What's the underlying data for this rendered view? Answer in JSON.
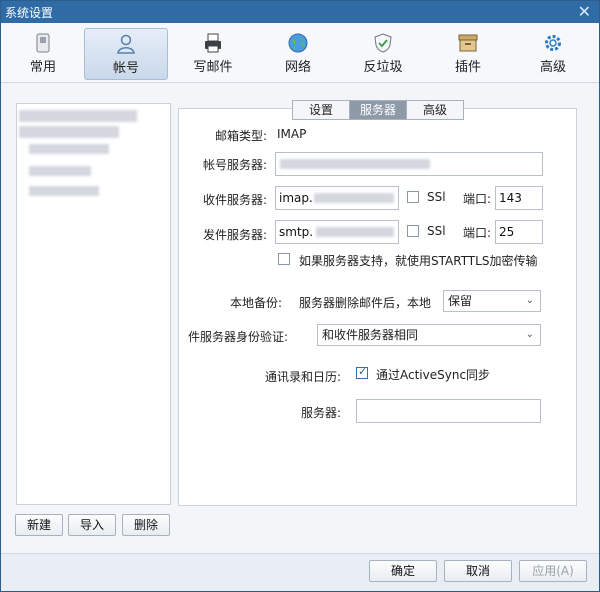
{
  "window": {
    "title": "系统设置",
    "close_label": "✕"
  },
  "toolbar": [
    {
      "name": "tool-general",
      "label": "常用",
      "icon": "phone-icon"
    },
    {
      "name": "tool-account",
      "label": "帐号",
      "icon": "user-icon"
    },
    {
      "name": "tool-compose",
      "label": "写邮件",
      "icon": "printer-icon"
    },
    {
      "name": "tool-network",
      "label": "网络",
      "icon": "globe-icon"
    },
    {
      "name": "tool-antispam",
      "label": "反垃圾",
      "icon": "shield-icon"
    },
    {
      "name": "tool-plugins",
      "label": "插件",
      "icon": "archive-box-icon"
    },
    {
      "name": "tool-advanced",
      "label": "高级",
      "icon": "gear-icon"
    }
  ],
  "active_tool": "帐号",
  "left_buttons": {
    "new": "新建",
    "import": "导入",
    "delete": "删除"
  },
  "tabs": [
    {
      "label": "设置",
      "active": false
    },
    {
      "label": "服务器",
      "active": true
    },
    {
      "label": "高级",
      "active": false
    }
  ],
  "form": {
    "mailbox_type_label": "邮箱类型:",
    "mailbox_type_value": "IMAP",
    "account_server_label": "帐号服务器:",
    "incoming_label": "收件服务器:",
    "incoming_value": "imap.",
    "incoming_ssl_label": "SSl",
    "incoming_port_label": "端口:",
    "incoming_port": "143",
    "outgoing_label": "发件服务器:",
    "outgoing_value": "smtp.",
    "outgoing_ssl_label": "SSl",
    "outgoing_port_label": "端口:",
    "outgoing_port": "25",
    "starttls_label": "如果服务器支持，就使用STARTTLS加密传输",
    "backup_label": "本地备份:",
    "backup_desc": "服务器删除邮件后，本地",
    "backup_value": "保留",
    "auth_label": "件服务器身份验证:",
    "auth_value": "和收件服务器相同",
    "contacts_label": "通讯录和日历:",
    "activesync_label": "通过ActiveSync同步",
    "activesync_checked": true,
    "server_label": "服务器:",
    "server_value": ""
  },
  "bottom_buttons": {
    "ok": "确定",
    "cancel": "取消",
    "apply": "应用(A)"
  }
}
